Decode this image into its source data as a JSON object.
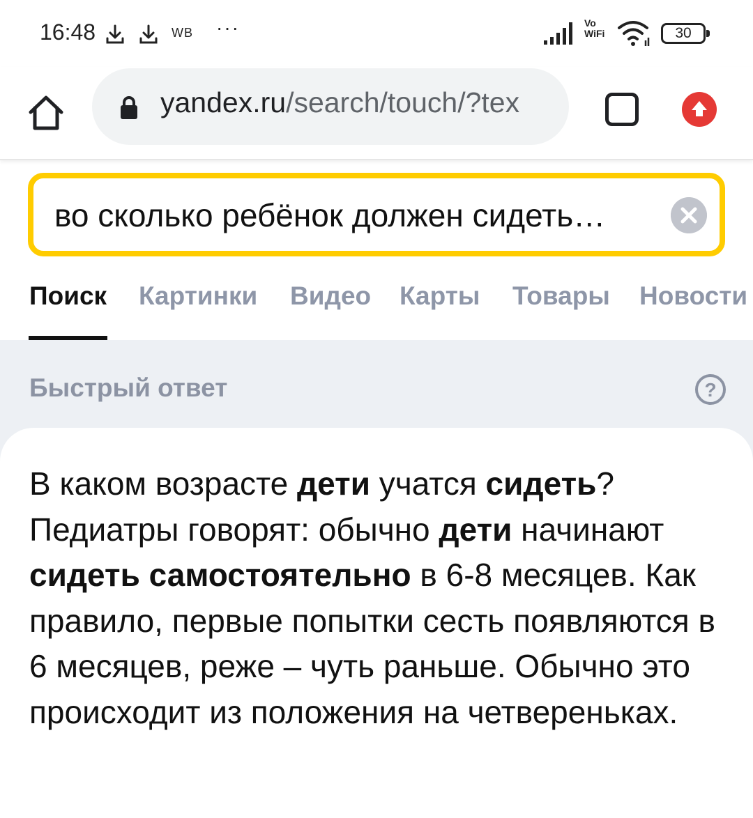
{
  "status_bar": {
    "time": "16:48",
    "wb_label": "WB",
    "more_dots": "···",
    "vowifi": "Vo WiFi",
    "battery": "30"
  },
  "browser": {
    "url_host": "yandex.ru",
    "url_path": "/search/touch/?tex"
  },
  "search": {
    "query": "во сколько ребёнок должен сидеть…"
  },
  "tabs": [
    {
      "label": "Поиск",
      "active": true
    },
    {
      "label": "Картинки",
      "active": false
    },
    {
      "label": "Видео",
      "active": false
    },
    {
      "label": "Карты",
      "active": false
    },
    {
      "label": "Товары",
      "active": false
    },
    {
      "label": "Новости",
      "active": false
    }
  ],
  "quick_answer": {
    "title": "Быстрый ответ",
    "help_symbol": "?",
    "segments": [
      {
        "text": "В каком возрасте ",
        "bold": false
      },
      {
        "text": "дети",
        "bold": true
      },
      {
        "text": " учатся ",
        "bold": false
      },
      {
        "text": "сидеть",
        "bold": true
      },
      {
        "text": "? Педиатры говорят: обычно ",
        "bold": false
      },
      {
        "text": "дети",
        "bold": true
      },
      {
        "text": " начинают ",
        "bold": false
      },
      {
        "text": "сидеть самостоятельно",
        "bold": true
      },
      {
        "text": " в 6-8 месяцев. Как правило, первые попытки сесть появляются в 6 месяцев, реже – чуть раньше. Обычно это происходит из положения на четвереньках.",
        "bold": false
      }
    ]
  },
  "colors": {
    "search_border": "#ffcc00",
    "update_badge": "#e53935",
    "grey_background": "#edf0f4",
    "inactive_tab": "#8e96a8"
  },
  "icons": {
    "home": "home-icon",
    "lock": "lock-icon",
    "tabs": "tab-switcher-icon",
    "update": "update-arrow-icon",
    "clear": "clear-icon",
    "help": "help-icon"
  }
}
